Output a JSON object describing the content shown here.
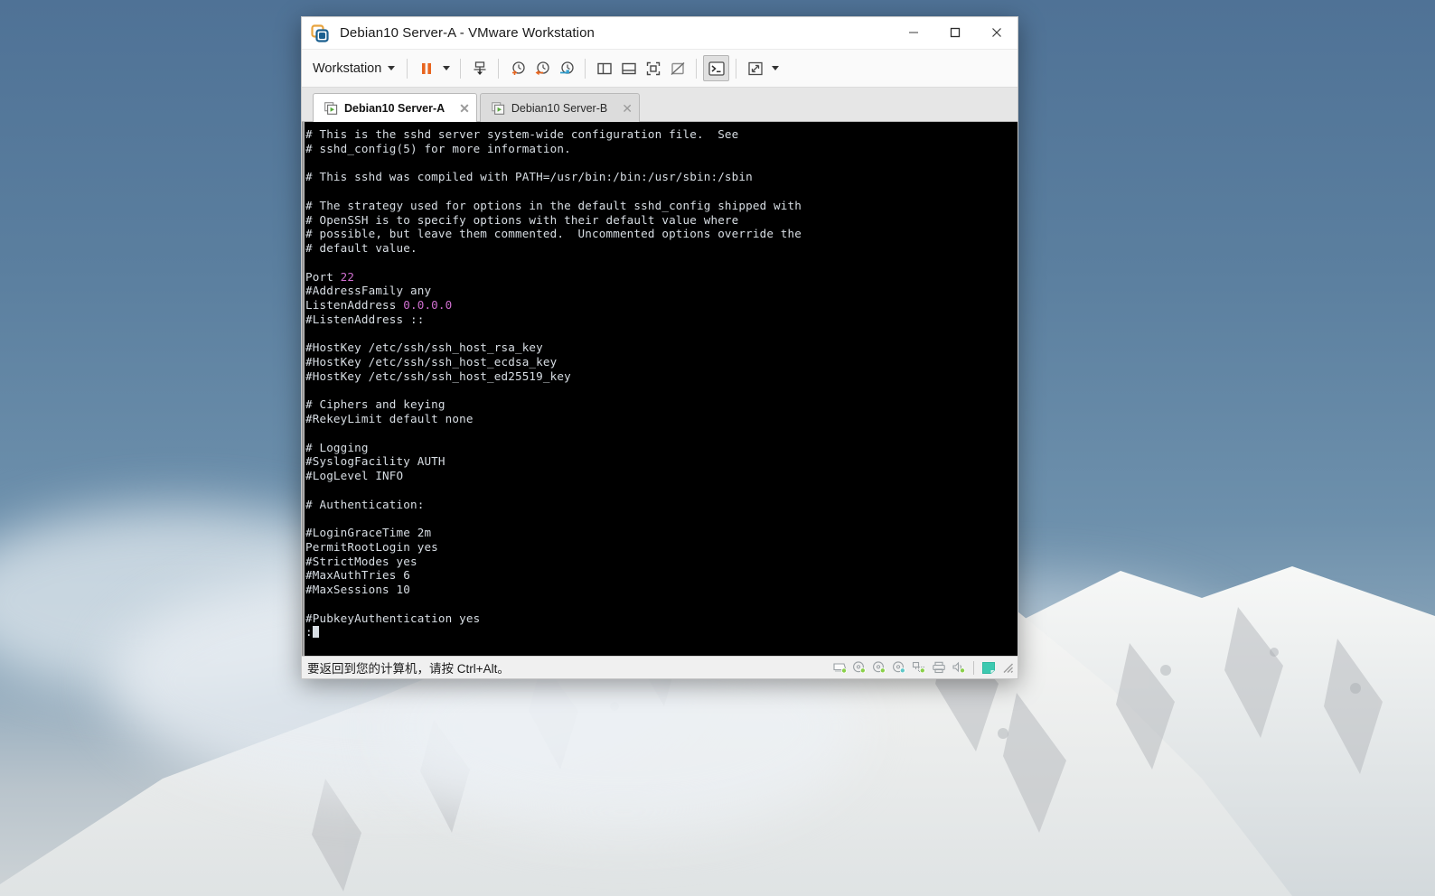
{
  "window": {
    "title": "Debian10 Server-A - VMware Workstation",
    "logo_icon": "vmware-logo-icon",
    "controls": [
      {
        "name": "minimize-button",
        "glyph": "–"
      },
      {
        "name": "maximize-button",
        "glyph": "□"
      },
      {
        "name": "close-button",
        "glyph": "✕"
      }
    ]
  },
  "toolbar": {
    "menu_label": "Workstation",
    "menu_caret_icon": "chevron-down-icon",
    "buttons": [
      {
        "name": "suspend-button",
        "icon": "pause-icon",
        "pressed": false
      },
      {
        "name": "suspend-dropdown",
        "icon": "chevron-down-icon",
        "pressed": false
      },
      {
        "name": "power-button",
        "icon": "power-vm-icon",
        "pressed": false
      },
      {
        "name": "take-snapshot-button",
        "icon": "snapshot-add-icon",
        "pressed": false
      },
      {
        "name": "revert-snapshot-button",
        "icon": "snapshot-revert-icon",
        "pressed": false
      },
      {
        "name": "manage-snapshots-button",
        "icon": "snapshot-manage-icon",
        "pressed": false
      },
      {
        "name": "show-left-pane-button",
        "icon": "library-pane-icon",
        "pressed": false
      },
      {
        "name": "show-bottom-pane-button",
        "icon": "thumbnail-pane-icon",
        "pressed": false
      },
      {
        "name": "fullscreen-button",
        "icon": "fullscreen-icon",
        "pressed": false
      },
      {
        "name": "unity-mode-button",
        "icon": "unity-mode-icon",
        "pressed": false
      },
      {
        "name": "console-view-button",
        "icon": "console-icon",
        "pressed": true
      },
      {
        "name": "stretch-view-button",
        "icon": "stretch-icon",
        "pressed": false
      },
      {
        "name": "stretch-dropdown",
        "icon": "chevron-down-icon",
        "pressed": false
      }
    ]
  },
  "tabs": [
    {
      "name": "tab-debian10-server-a",
      "label": "Debian10 Server-A",
      "active": true,
      "icon": "vm-powered-on-icon",
      "close_glyph": "✕"
    },
    {
      "name": "tab-debian10-server-b",
      "label": "Debian10 Server-B",
      "active": false,
      "icon": "vm-powered-on-icon",
      "close_glyph": "✕"
    }
  ],
  "terminal": {
    "lines": [
      [
        {
          "t": "# This is the sshd server system-wide configuration file.  See"
        }
      ],
      [
        {
          "t": "# sshd_config(5) for more information."
        }
      ],
      [
        {
          "t": ""
        }
      ],
      [
        {
          "t": "# This sshd was compiled with PATH=/usr/bin:/bin:/usr/sbin:/sbin"
        }
      ],
      [
        {
          "t": ""
        }
      ],
      [
        {
          "t": "# The strategy used for options in the default sshd_config shipped with"
        }
      ],
      [
        {
          "t": "# OpenSSH is to specify options with their default value where"
        }
      ],
      [
        {
          "t": "# possible, but leave them commented.  Uncommented options override the"
        }
      ],
      [
        {
          "t": "# default value."
        }
      ],
      [
        {
          "t": ""
        }
      ],
      [
        {
          "t": "Port "
        },
        {
          "t": "22",
          "c": "num"
        }
      ],
      [
        {
          "t": "#AddressFamily any"
        }
      ],
      [
        {
          "t": "ListenAddress "
        },
        {
          "t": "0.0.0.0",
          "c": "num"
        }
      ],
      [
        {
          "t": "#ListenAddress ::"
        }
      ],
      [
        {
          "t": ""
        }
      ],
      [
        {
          "t": "#HostKey /etc/ssh/ssh_host_rsa_key"
        }
      ],
      [
        {
          "t": "#HostKey /etc/ssh/ssh_host_ecdsa_key"
        }
      ],
      [
        {
          "t": "#HostKey /etc/ssh/ssh_host_ed25519_key"
        }
      ],
      [
        {
          "t": ""
        }
      ],
      [
        {
          "t": "# Ciphers and keying"
        }
      ],
      [
        {
          "t": "#RekeyLimit default none"
        }
      ],
      [
        {
          "t": ""
        }
      ],
      [
        {
          "t": "# Logging"
        }
      ],
      [
        {
          "t": "#SyslogFacility AUTH"
        }
      ],
      [
        {
          "t": "#LogLevel INFO"
        }
      ],
      [
        {
          "t": ""
        }
      ],
      [
        {
          "t": "# Authentication:"
        }
      ],
      [
        {
          "t": ""
        }
      ],
      [
        {
          "t": "#LoginGraceTime 2m"
        }
      ],
      [
        {
          "t": "PermitRootLogin yes"
        }
      ],
      [
        {
          "t": "#StrictModes yes"
        }
      ],
      [
        {
          "t": "#MaxAuthTries 6"
        }
      ],
      [
        {
          "t": "#MaxSessions 10"
        }
      ],
      [
        {
          "t": ""
        }
      ],
      [
        {
          "t": "#PubkeyAuthentication yes"
        }
      ],
      [
        {
          "t": ":",
          "cursor": true
        }
      ]
    ],
    "colors": {
      "background": "#000000",
      "foreground": "#d8dee4",
      "number": "#cf6fcf"
    }
  },
  "statusbar": {
    "message": "要返回到您的计算机，请按 Ctrl+Alt。",
    "devices": [
      {
        "name": "hard-disk-icon"
      },
      {
        "name": "cd-dvd-drive-1-icon"
      },
      {
        "name": "cd-dvd-drive-2-icon"
      },
      {
        "name": "cd-dvd-drive-3-icon"
      },
      {
        "name": "network-adapter-icon"
      },
      {
        "name": "printer-icon"
      },
      {
        "name": "sound-card-icon"
      }
    ],
    "indicator": {
      "name": "message-log-icon",
      "color": "#3dc9b0"
    },
    "resize_grip": "resize-grip-icon"
  },
  "desktop": {
    "wallpaper_name": "snowy-mountain-wallpaper",
    "sky_color": "#5b7f9f",
    "snow_color": "#f2f3f2"
  }
}
